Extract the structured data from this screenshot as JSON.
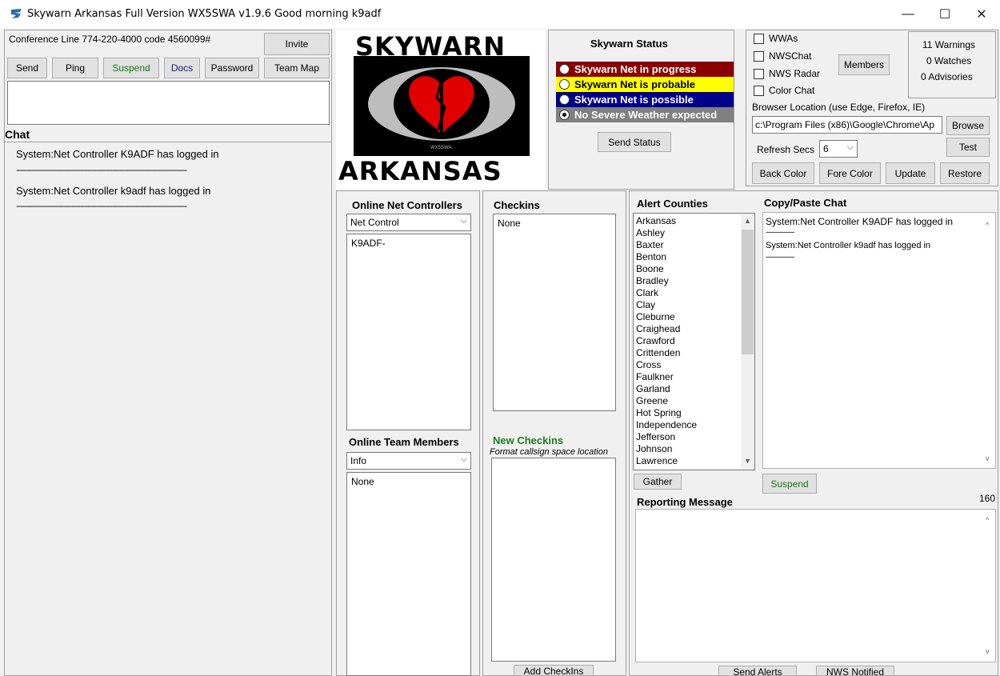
{
  "window": {
    "title": "Skywarn Arkansas Full Version WX5SWA v1.9.6  Good morning k9adf",
    "minimize": "—",
    "maximize": "☐",
    "close": "✕"
  },
  "left": {
    "conference": "Conference Line 774-220-4000 code 4560099#",
    "invite": "Invite",
    "buttons": [
      "Send",
      "Ping",
      "Suspend",
      "Docs",
      "Password",
      "Team Map"
    ],
    "chat_heading": "Chat",
    "chat_lines": [
      "System:Net Controller K9ADF has logged in",
      "--------------------------------------------------------------------------------",
      "System:Net Controller k9adf has logged in",
      "--------------------------------------------------------------------------------"
    ]
  },
  "logo": {
    "top_text": "SKYWARN",
    "bottom_text": "ARKANSAS",
    "small_text": "WX5SWA"
  },
  "status": {
    "title": "Skywarn Status",
    "options": [
      "Skywarn Net in progress",
      "Skywarn Net is probable",
      "Skywarn Net is possible",
      "No Severe Weather expected"
    ],
    "colors": [
      "#8b0000",
      "#ffff00",
      "#00008b",
      "#808080"
    ],
    "send_button": "Send Status"
  },
  "options": {
    "checkboxes": [
      "WWAs",
      "NWSChat",
      "NWS Radar",
      "Color Chat"
    ],
    "members_button": "Members",
    "counts": [
      "11 Warnings",
      "0 Watches",
      "0 Advisories"
    ],
    "browser_label": "Browser Location (use Edge, Firefox, IE)",
    "browser_value": "c:\\Program Files (x86)\\Google\\Chrome\\Ap",
    "browse_button": "Browse",
    "refresh_label": "Refresh Secs",
    "refresh_value": "6",
    "test_button": "Test",
    "buttons": [
      "Back Color",
      "Fore Color",
      "Update",
      "Restore"
    ]
  },
  "net_controllers": {
    "heading": "Online Net Controllers",
    "combo_value": "Net Control",
    "items": [
      "K9ADF-"
    ]
  },
  "team_members": {
    "heading": "Online Team Members",
    "combo_value": "Info",
    "items": [
      "None"
    ]
  },
  "checkins": {
    "heading": "Checkins",
    "items": [
      "None"
    ],
    "new_heading": "New Checkins",
    "new_hint": "Format callsign space location",
    "add_button": "Add CheckIns"
  },
  "alert_counties": {
    "heading": "Alert Counties",
    "items": [
      "Arkansas",
      "Ashley",
      "Baxter",
      "Benton",
      "Boone",
      "Bradley",
      "Clark",
      "Clay",
      "Cleburne",
      "Craighead",
      "Crawford",
      "Crittenden",
      "Cross",
      "Faulkner",
      "Garland",
      "Greene",
      "Hot Spring",
      "Independence",
      "Jefferson",
      "Johnson",
      "Lawrence"
    ],
    "gather_button": "Gather"
  },
  "copy_paste": {
    "heading": "Copy/Paste Chat",
    "lines": [
      "System:Net Controller K9ADF has logged in",
      "------------------",
      "System:Net Controller k9adf has logged in",
      "------------------"
    ],
    "suspend_button": "Suspend"
  },
  "reporting": {
    "heading": "Reporting Message",
    "count": "160",
    "send_alerts": "Send Alerts",
    "nws_notified": "NWS Notified"
  }
}
